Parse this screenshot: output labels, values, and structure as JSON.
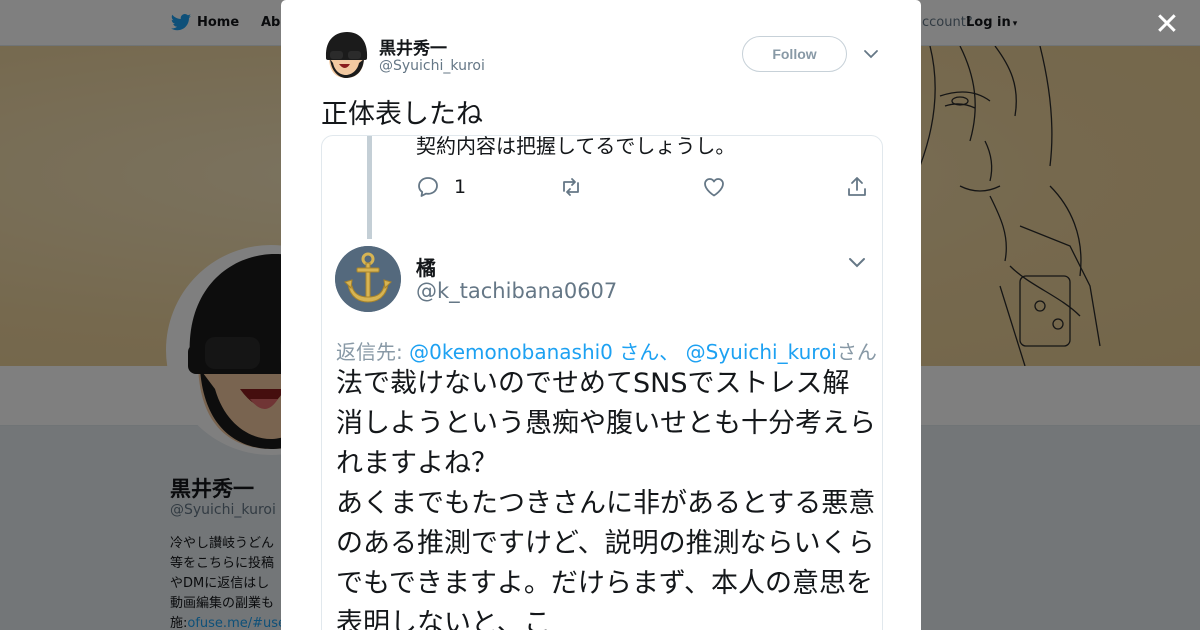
{
  "nav": {
    "home_label": "Home",
    "about_label": "Abo",
    "account_prompt": "account?",
    "login_label": "Log in"
  },
  "profile": {
    "name": "黒井秀一",
    "handle": "@Syuichi_kuroi",
    "bio_lines": [
      "冷やし讃岐うどん",
      "等をこちらに投稿",
      "やDMに返信はし",
      "動画編集の副業も"
    ],
    "bio_link_prefix": "施:",
    "bio_link": "ofuse.me/#use"
  },
  "modal": {
    "close_icon": "close-icon",
    "author_name": "黒井秀一",
    "author_handle": "@Syuichi_kuroi",
    "follow_label": "Follow",
    "tweet_text": "正体表したね"
  },
  "quoted": {
    "previous_text": "契約内容は把握してるでしょうし。",
    "reply_count": "1",
    "author_name": "橘",
    "author_handle": "@k_tachibana0607",
    "reply_to_prefix": "返信先: ",
    "reply_to_mention1": "@0kemonobanashi0",
    "reply_to_sep": " さん、 ",
    "reply_to_mention2": "@Syuichi_kuroi",
    "reply_to_suffix": "さん",
    "body": "法で裁けないのでせめてSNSでストレス解消しようという愚痴や腹いせとも十分考えられますよね？\nあくまでもたつきさんに非があるとする悪意のある推測ですけど、説明の推測ならいくらでもできますよ。だけらまず、本人の意思を表明しないと、こ"
  },
  "colors": {
    "accent": "#1da1f2",
    "text": "#14171a",
    "muted": "#657786"
  }
}
